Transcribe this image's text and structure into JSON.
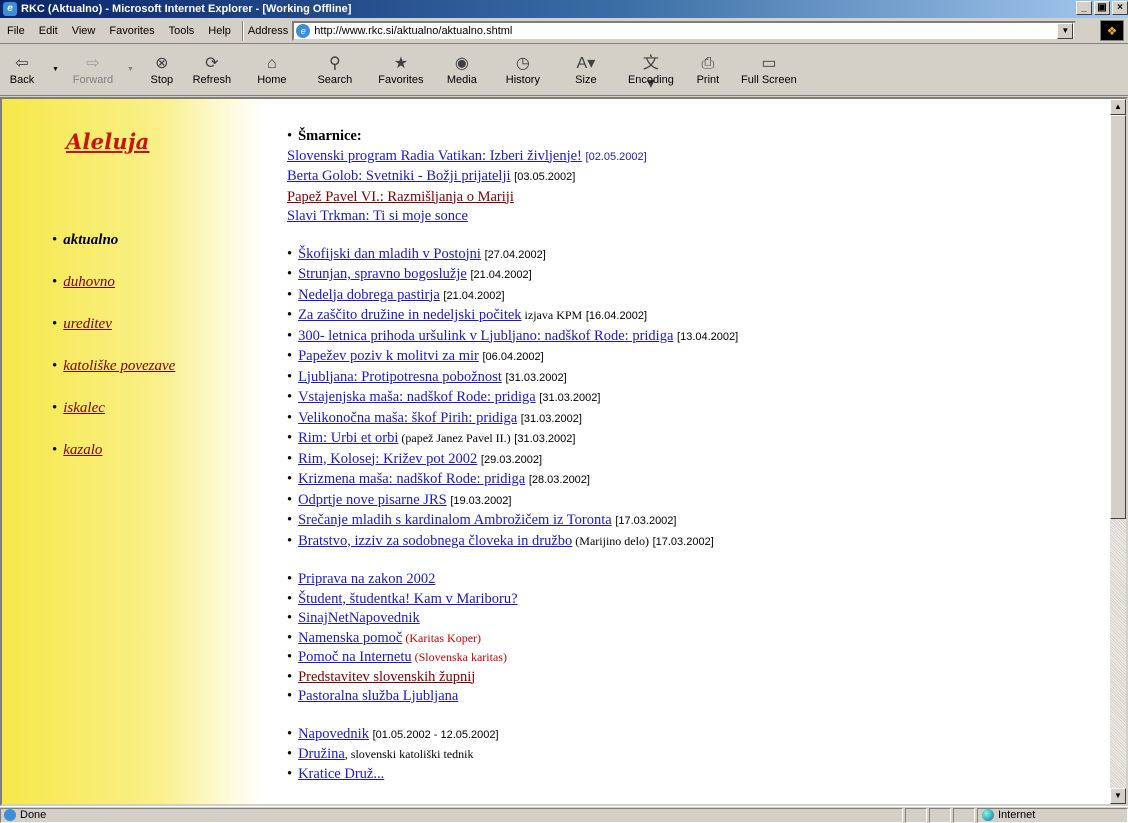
{
  "window": {
    "title": "RKC (Aktualno) - Microsoft Internet Explorer - [Working Offline]",
    "controls": [
      "_",
      "\u0000",
      "x"
    ]
  },
  "menu": {
    "items": [
      "File",
      "Edit",
      "View",
      "Favorites",
      "Tools",
      "Help"
    ],
    "address_label": "Address",
    "url": "http://www.rkc.si/aktualno/aktualno.shtml"
  },
  "toolbar": {
    "back": "Back",
    "forward": "Forward",
    "stop": "Stop",
    "refresh": "Refresh",
    "home": "Home",
    "search": "Search",
    "favorites": "Favorites",
    "media": "Media",
    "history": "History",
    "size": "Size",
    "encoding": "Encoding",
    "print": "Print",
    "fullscreen": "Full Screen"
  },
  "sidebar": {
    "title": "Aleluja",
    "items": [
      {
        "label": "aktualno"
      },
      {
        "label": "duhovno"
      },
      {
        "label": "ureditev"
      },
      {
        "label": "katoliške povezave"
      },
      {
        "label": "iskalec"
      },
      {
        "label": "kazalo"
      }
    ]
  },
  "content": {
    "smarnice": {
      "heading": "Šmarnice:",
      "items": [
        {
          "link": "Slovenski program Radia Vatikan: Izberi življenje!",
          "date": "[02.05.2002]"
        },
        {
          "link": "Berta Golob: Svetniki - Božji prijatelji",
          "date": "[03.05.2002]"
        },
        {
          "link": "Papež Pavel VI.: Razmišljanja o Mariji"
        },
        {
          "link": "Slavi Trkman: Ti si moje sonce"
        }
      ]
    },
    "news": [
      {
        "link": "Škofijski dan mladih v Postojni",
        "date": "[27.04.2002]"
      },
      {
        "link": "Strunjan, spravno bogoslužje",
        "date": "[21.04.2002]"
      },
      {
        "link": "Nedelja dobrega pastirja",
        "date": "[21.04.2002]"
      },
      {
        "link": "Za zaščito družine in nedeljski počitek",
        "note": " izjava KPM",
        "date": " [16.04.2002]"
      },
      {
        "link": "300- letnica prihoda uršulink v Ljubljano: nadškof Rode: pridiga",
        "date": "[13.04.2002]"
      },
      {
        "link": "Papežev poziv k molitvi za mir",
        "date": "[06.04.2002]"
      },
      {
        "link": "Ljubljana: Protipotresna pobožnost",
        "date": "[31.03.2002]"
      },
      {
        "link": "Vstajenjska maša: nadškof Rode: pridiga",
        "date": "[31.03.2002]"
      },
      {
        "link": "Velikonočna maša: škof Pirih: pridiga",
        "date": "[31.03.2002]"
      },
      {
        "link": "Rim: Urbi et orbi",
        "note": " (papež Janez Pavel II.)",
        "date": "[31.03.2002]"
      },
      {
        "link": "Rim, Kolosej: Križev pot 2002",
        "date": "[29.03.2002]"
      },
      {
        "link": "Krizmena maša: nadškof Rode: pridiga",
        "date": "[28.03.2002]"
      },
      {
        "link": "Odprtje nove pisarne JRS",
        "date": "[19.03.2002]"
      },
      {
        "link": "Srečanje mladih s kardinalom Ambrožičem iz Toronta",
        "date": "[17.03.2002]"
      },
      {
        "link": "Bratstvo, izziv za sodobnega človeka in družbo",
        "note": " (Marijino delo)",
        "date": " [17.03.2002]"
      }
    ],
    "links": [
      {
        "link": "Priprava na zakon 2002"
      },
      {
        "link": "Študent, študentka! Kam v Mariboru?"
      },
      {
        "link": "SinajNetNapovednik"
      },
      {
        "link": "Namenska pomoč",
        "red": " (Karitas Koper)"
      },
      {
        "link": "Pomoč na Internetu",
        "red": " (Slovenska karitas)"
      },
      {
        "link": "Predstavitev slovenskih župnij"
      },
      {
        "link": "Pastoralna služba Ljubljana"
      }
    ],
    "bottom": [
      {
        "link": "Napovednik",
        "date": "[01.05.2002 - 12.05.2002]"
      },
      {
        "link": "Družina",
        "note": ", slovenski katoliški tednik"
      },
      {
        "link": "Kratice Druž..."
      }
    ]
  },
  "status": {
    "text": "Done",
    "zone": "Internet"
  }
}
